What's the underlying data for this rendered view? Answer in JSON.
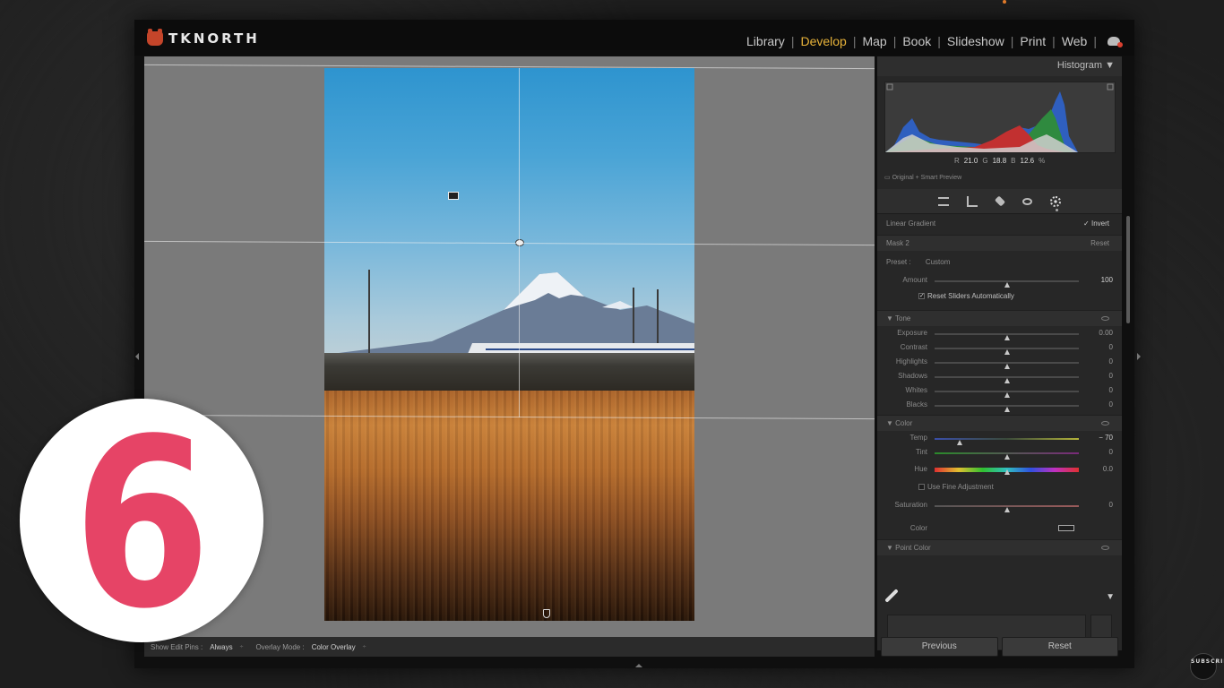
{
  "brand": {
    "name": "TKNORTH"
  },
  "modules": [
    {
      "label": "Library",
      "active": false
    },
    {
      "label": "Develop",
      "active": true
    },
    {
      "label": "Map",
      "active": false
    },
    {
      "label": "Book",
      "active": false
    },
    {
      "label": "Slideshow",
      "active": false
    },
    {
      "label": "Print",
      "active": false
    },
    {
      "label": "Web",
      "active": false
    }
  ],
  "colors": {
    "active_module": "#e8b33a",
    "step_badge": "#e64466",
    "badge_bg": "#ffffff"
  },
  "toolbar": {
    "show_edit_pins_label": "Show Edit Pins :",
    "show_edit_pins_value": "Always",
    "overlay_mode_label": "Overlay Mode :",
    "overlay_mode_value": "Color Overlay"
  },
  "histogram": {
    "title": "Histogram",
    "r_label": "R",
    "r_value": "21.0",
    "g_label": "G",
    "g_value": "18.8",
    "b_label": "B",
    "b_value": "12.6",
    "unit": "%",
    "preview_note": "Original + Smart Preview"
  },
  "mask": {
    "tool_name": "Linear Gradient",
    "invert_label": "Invert",
    "mask_name": "Mask 2",
    "reset_label": "Reset",
    "preset_label": "Preset :",
    "preset_value": "Custom",
    "amount_label": "Amount",
    "amount_value": "100",
    "reset_sliders_label": "Reset Sliders Automatically"
  },
  "tone": {
    "title": "Tone",
    "sliders": [
      {
        "label": "Exposure",
        "value": "0.00"
      },
      {
        "label": "Contrast",
        "value": "0"
      },
      {
        "label": "Highlights",
        "value": "0"
      },
      {
        "label": "Shadows",
        "value": "0"
      },
      {
        "label": "Whites",
        "value": "0"
      },
      {
        "label": "Blacks",
        "value": "0"
      }
    ]
  },
  "color": {
    "title": "Color",
    "temp_label": "Temp",
    "temp_value": "− 70",
    "tint_label": "Tint",
    "tint_value": "0",
    "hue_label": "Hue",
    "hue_value": "0.0",
    "fine_adjust_label": "Use Fine Adjustment",
    "saturation_label": "Saturation",
    "saturation_value": "0",
    "color_label": "Color"
  },
  "point_color": {
    "title": "Point Color"
  },
  "buttons": {
    "previous": "Previous",
    "reset": "Reset"
  },
  "step_number": "6",
  "subscribe_text": "SUBSCRIBE"
}
